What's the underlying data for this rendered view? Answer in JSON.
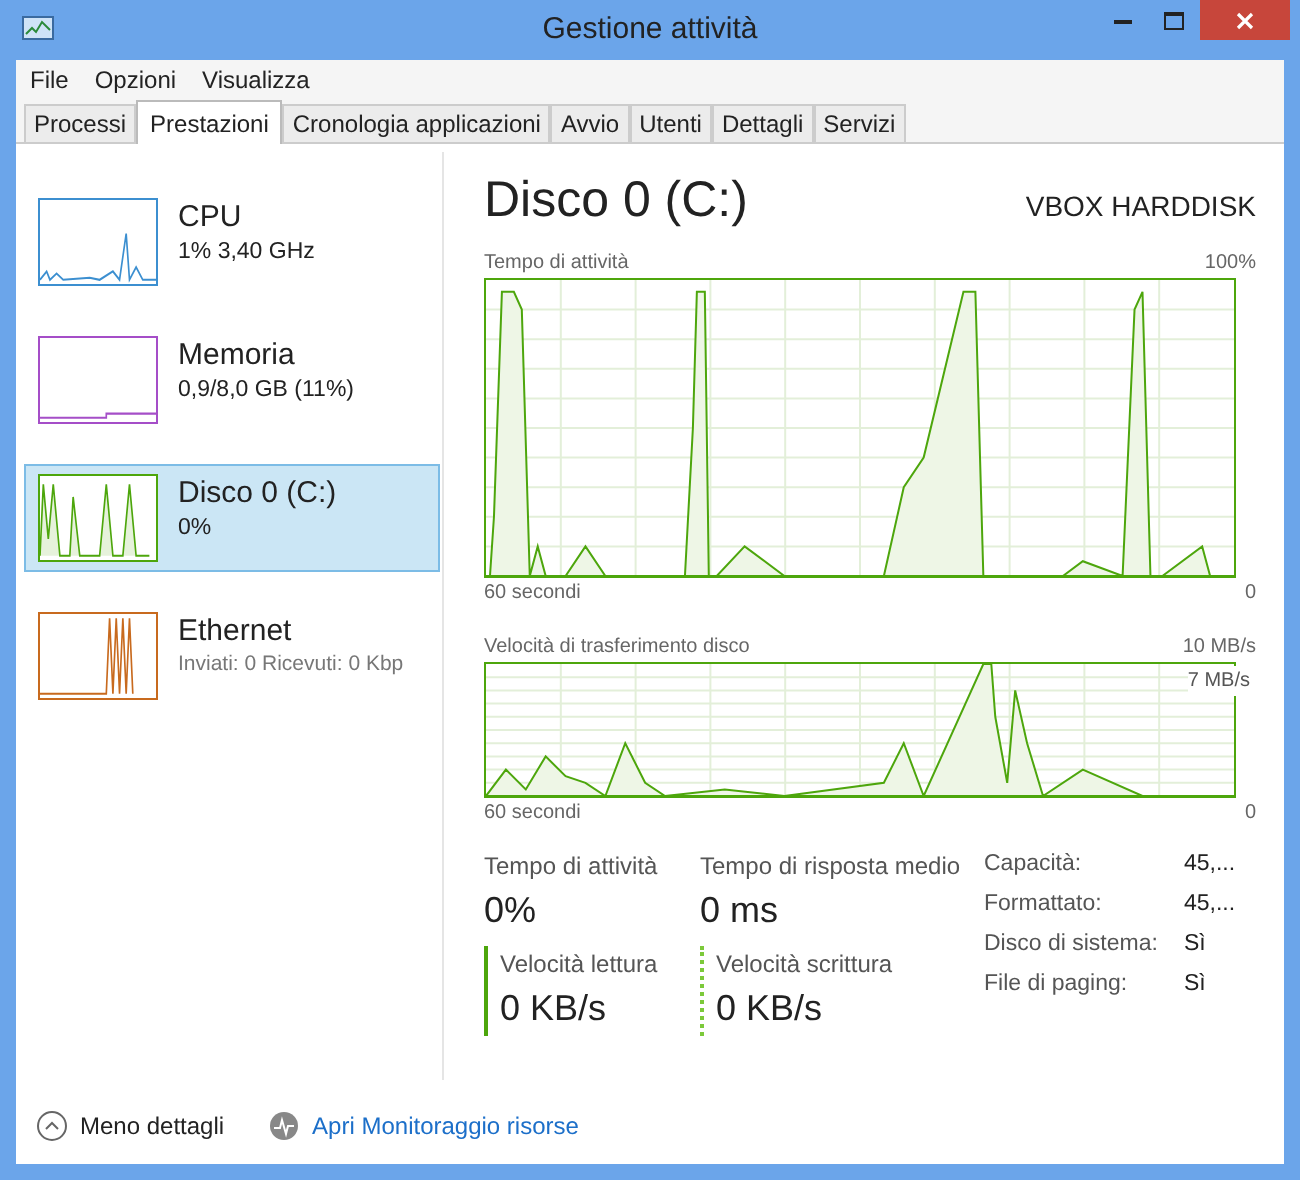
{
  "window": {
    "title": "Gestione attività"
  },
  "menu": [
    "File",
    "Opzioni",
    "Visualizza"
  ],
  "tabs": [
    {
      "label": "Processi",
      "selected": false
    },
    {
      "label": "Prestazioni",
      "selected": true
    },
    {
      "label": "Cronologia applicazioni",
      "selected": false
    },
    {
      "label": "Avvio",
      "selected": false
    },
    {
      "label": "Utenti",
      "selected": false
    },
    {
      "label": "Dettagli",
      "selected": false
    },
    {
      "label": "Servizi",
      "selected": false
    }
  ],
  "sidebar": {
    "items": [
      {
        "name": "CPU",
        "detail": "1% 3,40 GHz",
        "color": "#3c8fd0",
        "selected": false
      },
      {
        "name": "Memoria",
        "detail": "0,9/8,0 GB (11%)",
        "color": "#a54ec8",
        "selected": false
      },
      {
        "name": "Disco 0 (C:)",
        "detail": "0%",
        "color": "#4da60c",
        "selected": true
      },
      {
        "name": "Ethernet",
        "detail": "Inviati: 0 Ricevuti: 0 Kbp",
        "color": "#c86a1e",
        "selected": false
      }
    ]
  },
  "detail": {
    "title": "Disco 0 (C:)",
    "model": "VBOX HARDDISK",
    "activity_graph": {
      "label": "Tempo di attività",
      "max": "100%",
      "time": "60 secondi",
      "min": "0"
    },
    "transfer_graph": {
      "label": "Velocità di trasferimento disco",
      "max": "10 MB/s",
      "inner_max": "7 MB/s",
      "time": "60 secondi",
      "min": "0"
    },
    "stats": [
      {
        "label": "Tempo di attività",
        "value": "0%"
      },
      {
        "label": "Tempo di risposta medio",
        "value": "0 ms"
      }
    ],
    "rates": [
      {
        "label": "Velocità lettura",
        "value": "0 KB/s",
        "kind": "solid"
      },
      {
        "label": "Velocità scrittura",
        "value": "0 KB/s",
        "kind": "dotted"
      }
    ],
    "properties": [
      {
        "label": "Capacità:",
        "value": "45,..."
      },
      {
        "label": "Formattato:",
        "value": "45,..."
      },
      {
        "label": "Disco di sistema:",
        "value": "Sì"
      },
      {
        "label": "File di paging:",
        "value": "Sì"
      }
    ]
  },
  "footer": {
    "less": "Meno dettagli",
    "monitor": "Apri Monitoraggio risorse"
  }
}
